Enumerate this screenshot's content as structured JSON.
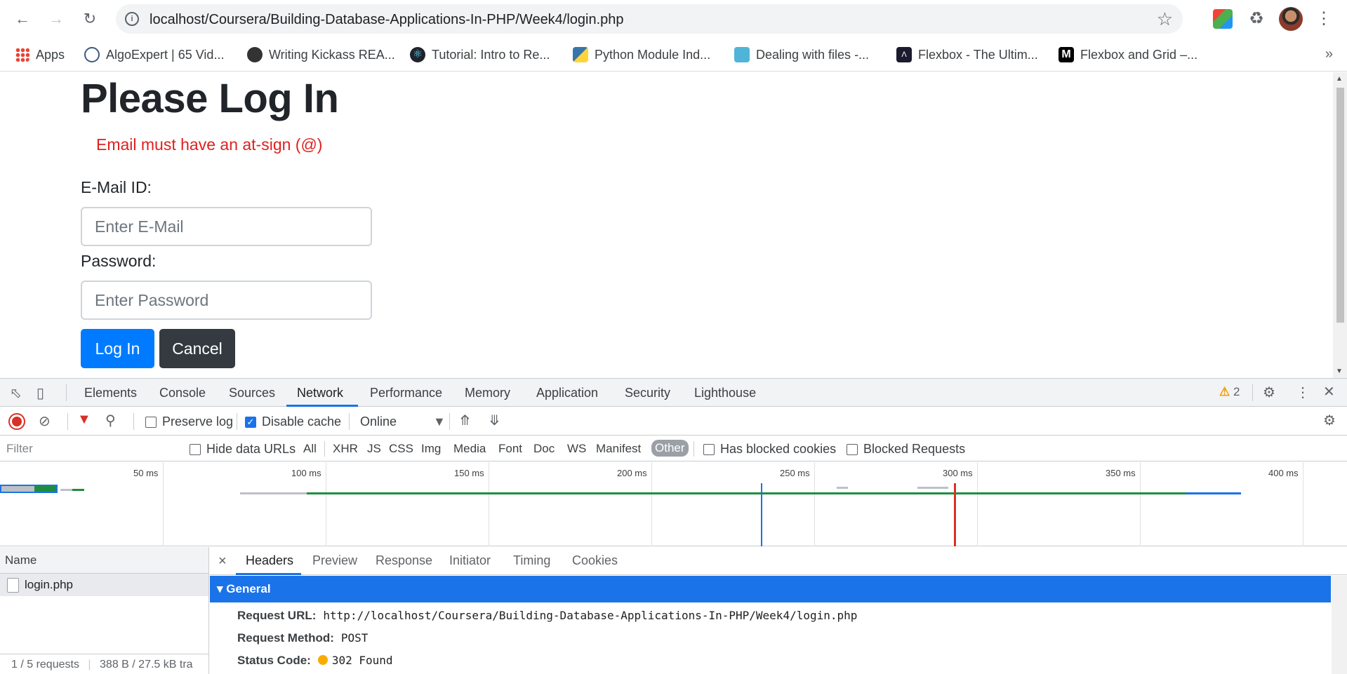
{
  "browser": {
    "url": "localhost/Coursera/Building-Database-Applications-In-PHP/Week4/login.php",
    "bookmarks": [
      {
        "label": "Apps",
        "icon": "apps-grid-icon"
      },
      {
        "label": "AlgoExpert | 65 Vid...",
        "icon": "algoexpert-icon"
      },
      {
        "label": "Writing Kickass REA...",
        "icon": "globe-icon"
      },
      {
        "label": "Tutorial: Intro to Re...",
        "icon": "react-icon"
      },
      {
        "label": "Python Module Ind...",
        "icon": "python-icon"
      },
      {
        "label": "Dealing with files -...",
        "icon": "bird-icon"
      },
      {
        "label": "Flexbox - The Ultim...",
        "icon": "flexbox-icon"
      },
      {
        "label": "Flexbox and Grid –...",
        "icon": "medium-icon"
      }
    ]
  },
  "page": {
    "title": "Please Log In",
    "error": "Email must have an at-sign (@)",
    "email_label": "E-Mail ID:",
    "email_placeholder": "Enter E-Mail",
    "password_label": "Password:",
    "password_placeholder": "Enter Password",
    "login_button": "Log In",
    "cancel_button": "Cancel"
  },
  "devtools": {
    "tabs": [
      "Elements",
      "Console",
      "Sources",
      "Network",
      "Performance",
      "Memory",
      "Application",
      "Security",
      "Lighthouse"
    ],
    "active_tab": "Network",
    "warning_count": "2",
    "preserve_log": "Preserve log",
    "disable_cache": "Disable cache",
    "throttling": "Online",
    "filter_placeholder": "Filter",
    "hide_data_urls": "Hide data URLs",
    "filter_types": [
      "All",
      "XHR",
      "JS",
      "CSS",
      "Img",
      "Media",
      "Font",
      "Doc",
      "WS",
      "Manifest",
      "Other"
    ],
    "selected_filter_type": "Other",
    "has_blocked_cookies": "Has blocked cookies",
    "blocked_requests": "Blocked Requests",
    "timeline_labels": [
      "50 ms",
      "100 ms",
      "150 ms",
      "200 ms",
      "250 ms",
      "300 ms",
      "350 ms",
      "400 ms"
    ],
    "name_header": "Name",
    "request_name": "login.php",
    "summary": "1 / 5 requests",
    "transferred": "388 B / 27.5 kB tra",
    "detail_tabs": [
      "Headers",
      "Preview",
      "Response",
      "Initiator",
      "Timing",
      "Cookies"
    ],
    "active_detail_tab": "Headers",
    "general_title": "General",
    "request_url_label": "Request URL:",
    "request_url": "http://localhost/Coursera/Building-Database-Applications-In-PHP/Week4/login.php",
    "request_method_label": "Request Method:",
    "request_method": "POST",
    "status_code_label": "Status Code:",
    "status_code": "302 Found"
  },
  "colors": {
    "primary_button": "#007bff",
    "dark_button": "#343a40",
    "error": "#e02020",
    "devtools_accent": "#1a73e8"
  }
}
